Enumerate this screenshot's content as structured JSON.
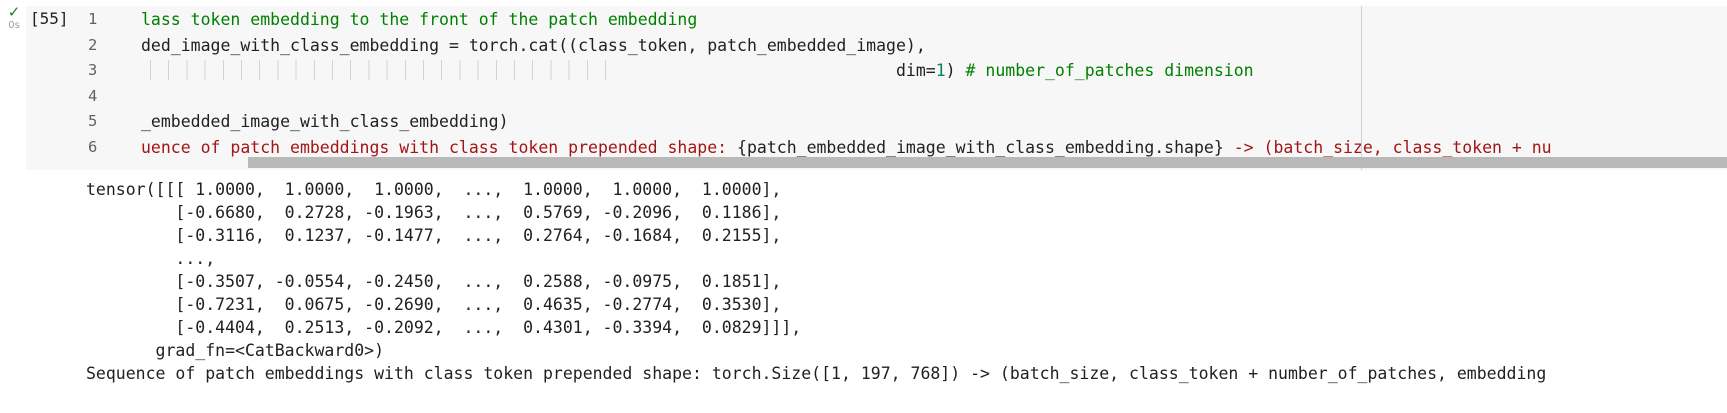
{
  "cell": {
    "run_icon": "check-icon",
    "run_icon_glyph": "✓",
    "run_time": "0s",
    "execution_count": "[55]",
    "lines": [
      {
        "number": "1",
        "tokens": [
          {
            "t": "comment",
            "v": "lass token embedding to the front of the patch embedding"
          }
        ]
      },
      {
        "number": "2",
        "tokens": [
          {
            "t": "plain",
            "v": "ded_image_with_class_embedding = torch.cat((class_token, patch_embedded_image),"
          }
        ]
      },
      {
        "number": "3",
        "tokens": [
          {
            "t": "plain",
            "v": "                                                                            dim="
          },
          {
            "t": "number",
            "v": "1"
          },
          {
            "t": "plain",
            "v": ") "
          },
          {
            "t": "comment",
            "v": "# number_of_patches dimension"
          }
        ]
      },
      {
        "number": "4",
        "tokens": []
      },
      {
        "number": "5",
        "tokens": [
          {
            "t": "plain",
            "v": "_embedded_image_with_class_embedding)"
          }
        ]
      },
      {
        "number": "6",
        "tokens": [
          {
            "t": "string",
            "v": "uence of patch embeddings with class token prepended shape: "
          },
          {
            "t": "plain",
            "v": "{patch_embedded_image_with_class_embedding.shape}"
          },
          {
            "t": "string",
            "v": " -> (batch_size, class_token + nu"
          }
        ]
      }
    ]
  },
  "output": {
    "lines": [
      "tensor([[[ 1.0000,  1.0000,  1.0000,  ...,  1.0000,  1.0000,  1.0000],",
      "         [-0.6680,  0.2728, -0.1963,  ...,  0.5769, -0.2096,  0.1186],",
      "         [-0.3116,  0.1237, -0.1477,  ...,  0.2764, -0.1684,  0.2155],",
      "         ...,",
      "         [-0.3507, -0.0554, -0.2450,  ...,  0.2588, -0.0975,  0.1851],",
      "         [-0.7231,  0.0675, -0.2690,  ...,  0.4635, -0.2774,  0.3530],",
      "         [-0.4404,  0.2513, -0.2092,  ...,  0.4301, -0.3394,  0.0829]]],",
      "       grad_fn=<CatBackward0>)",
      "Sequence of patch embeddings with class token prepended shape: torch.Size([1, 197, 768]) -> (batch_size, class_token + number_of_patches, embedding"
    ]
  }
}
